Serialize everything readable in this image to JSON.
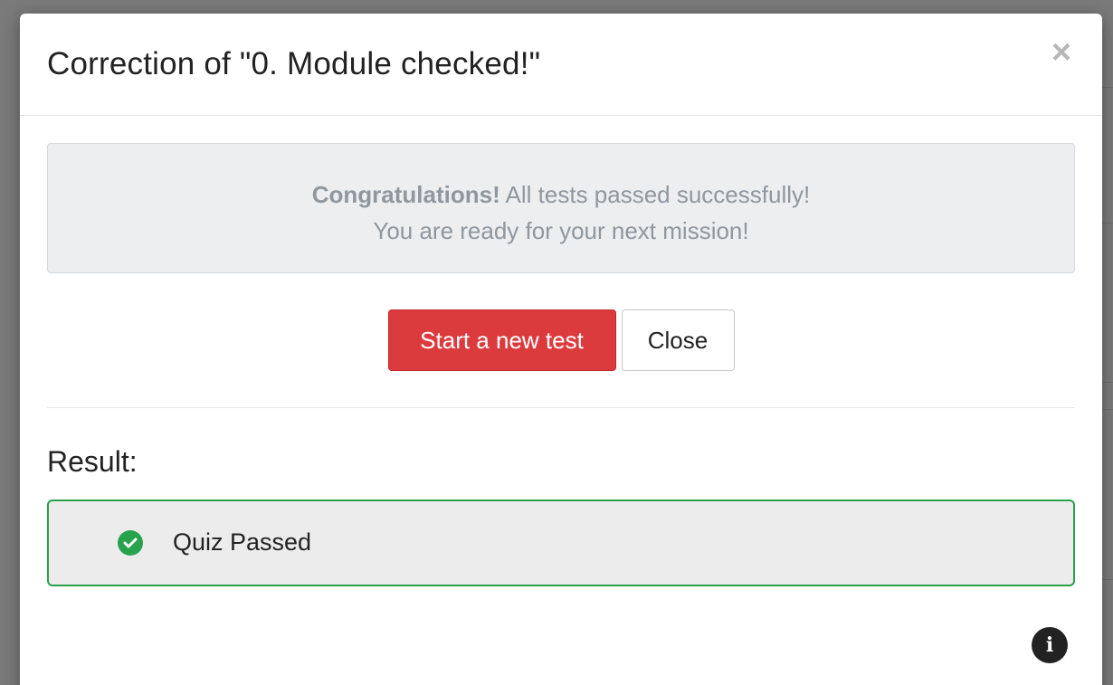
{
  "modal": {
    "title": "Correction of \"0. Module checked!\"",
    "close_glyph": "×"
  },
  "alert": {
    "strong": "Congratulations!",
    "line1_rest": " All tests passed successfully!",
    "line2": "You are ready for your next mission!"
  },
  "buttons": {
    "start_label": "Start a new test",
    "close_label": "Close"
  },
  "result": {
    "heading": "Result:",
    "status_label": "Quiz Passed",
    "status_icon": "check-circle-icon",
    "status_color": "#28a24c"
  },
  "footer": {
    "info_glyph": "i",
    "info_icon": "info-circle-icon"
  },
  "colors": {
    "danger": "#dc3b3e",
    "success_border": "#2aa04d",
    "muted_text": "#8f979f"
  }
}
